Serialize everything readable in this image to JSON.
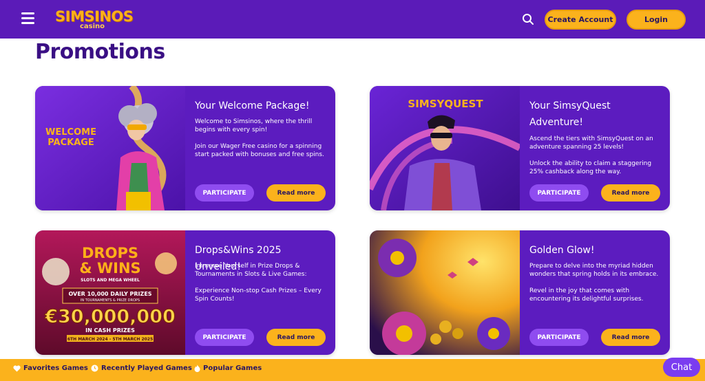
{
  "header": {
    "logo_main": "SIMSINOS",
    "logo_sub": "casino",
    "create_account_label": "Create Account",
    "login_label": "Login",
    "icons": [
      "menu-icon",
      "search-icon"
    ]
  },
  "page": {
    "title": "Promotions"
  },
  "cards": [
    {
      "title": "Your Welcome Package!",
      "image_text": "WELCOME\nPACKAGE",
      "desc1": "Welcome to Simsinos, where the thrill begins with every spin!",
      "desc2": "Join our Wager Free casino for a spinning start packed with bonuses and free spins.",
      "participate": "PARTICIPATE",
      "read_more": "Read more"
    },
    {
      "title": "Your SimsyQuest Adventure!",
      "image_text": "SIMSYQUEST",
      "desc1": "Ascend the tiers with SimsyQuest on an adventure spanning 25 levels!",
      "desc2": "Unlock the ability to claim a staggering 25% cashback along the way.",
      "participate": "PARTICIPATE",
      "read_more": "Read more"
    },
    {
      "title": "Drops&Wins 2025 Unveiled!",
      "image_line1": "DROPS",
      "image_line2": "& WINS",
      "image_line3": "SLOTS AND MEGA WHEEL",
      "image_line4": "OVER 10,000 DAILY PRIZES",
      "image_line5": "IN TOURNAMENTS & PRIZE DROPS",
      "image_line6": "€30,000,000",
      "image_line7": "IN CASH PRIZES",
      "image_line8": "6TH MARCH 2024 - 5TH MARCH 2025",
      "desc1": "Immerse Yourself in Prize Drops & Tournaments in Slots & Live Games:",
      "desc2": "Experience Non-stop Cash Prizes – Every Spin Counts!",
      "participate": "PARTICIPATE",
      "read_more": "Read more"
    },
    {
      "title": "Golden Glow!",
      "desc1": "Prepare to delve into the myriad hidden wonders that spring holds in its embrace.",
      "desc2": "Revel in the joy that comes with encountering its delightful surprises.",
      "participate": "PARTICIPATE",
      "read_more": "Read more"
    }
  ],
  "footer": {
    "favorites": "Favorites Games",
    "recent": "Recently Played Games",
    "popular": "Popular Games",
    "chat": "Chat"
  },
  "colors": {
    "header_bg": "#5b1bb8",
    "card_bg": "#5c1cbf",
    "accent_yellow": "#fbb21c",
    "title_purple": "#3a0f84",
    "participate_bg": "#8f4cf0"
  }
}
